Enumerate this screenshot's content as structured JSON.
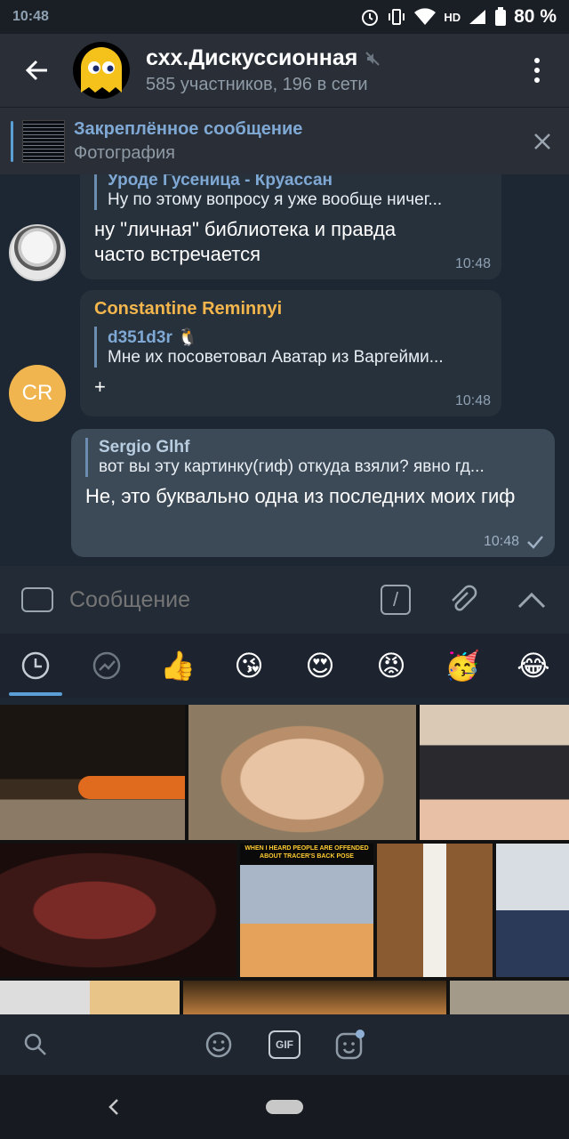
{
  "status": {
    "time": "10:48",
    "battery": "80 %",
    "network": "HD"
  },
  "header": {
    "title": "схх.Дискуссионная",
    "subtitle": "585 участников, 196 в сети"
  },
  "pinned": {
    "title": "Закреплённое сообщение",
    "subtitle": "Фотография"
  },
  "messages": [
    {
      "quote_name": "Уроде Гусеница - Круассан",
      "quote_text": "Ну по этому вопросу я уже вообще ничег...",
      "text": "ну \"личная\" библиотека и правда часто встречается",
      "time": "10:48"
    },
    {
      "sender": "Constantine Reminnyi",
      "avatar_initials": "CR",
      "quote_name": "d351d3r 🐧",
      "quote_text": "Мне их посоветовал Аватар из Варгейми...",
      "text": "+",
      "time": "10:48"
    },
    {
      "quote_name": "Sergio Glhf",
      "quote_text": "вот вы эту картинку(гиф) откуда взяли? явно гд...",
      "text": "Не, это буквально одна из последних моих гиф",
      "time": "10:48"
    }
  ],
  "input": {
    "placeholder": "Сообщение"
  },
  "emoji_tabs": [
    "recent-icon",
    "trending-icon",
    "👍",
    "😘",
    "😍",
    "😡",
    "🥳",
    "😂"
  ],
  "gifs": {
    "caption": "WHEN I HEARD PEOPLE ARE OFFENDED ABOUT TRACER'S BACK POSE"
  },
  "bottom_nav": [
    "search-icon",
    "emoji-icon",
    "GIF",
    "sticker-icon"
  ],
  "colors": {
    "accent": "#5a9fd6",
    "sender": "#f3b64d",
    "bg": "#1d2733"
  }
}
